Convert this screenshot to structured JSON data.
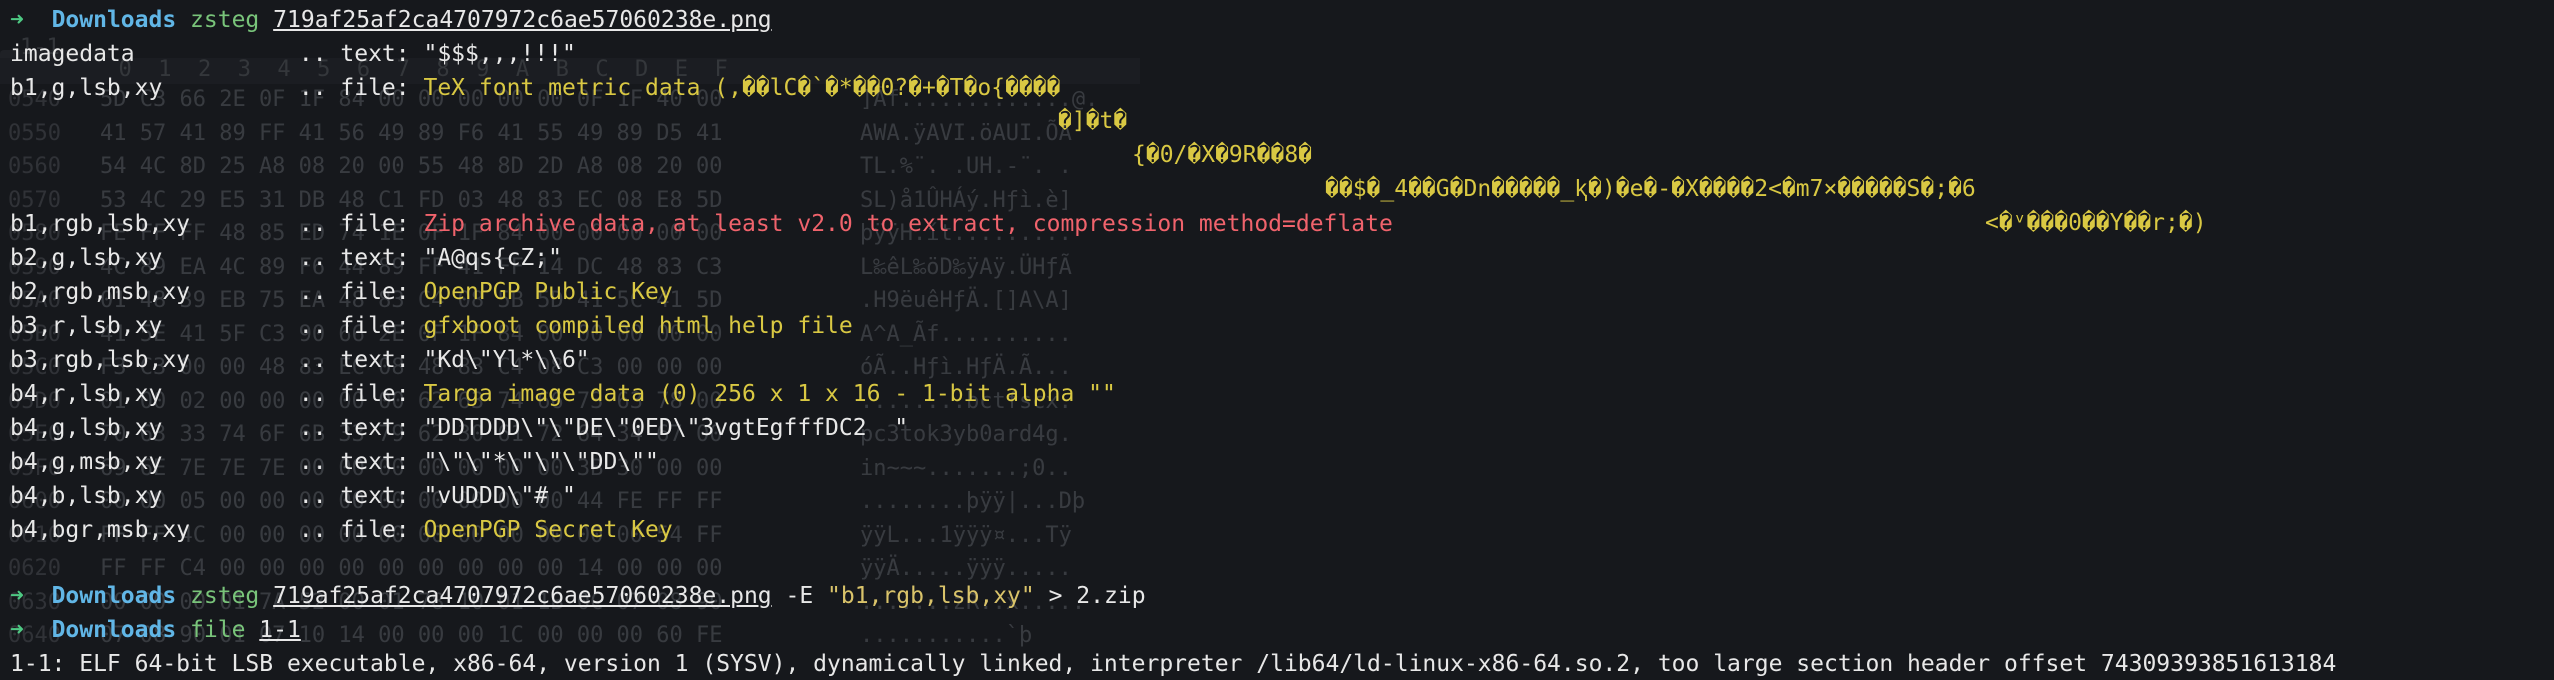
{
  "colors": {
    "background": "#16181c",
    "prompt_arrow": "#4ec983",
    "cwd": "#61b6e6",
    "command": "#79c47a",
    "file_type": "#d9c843",
    "zip_highlight": "#f0636c"
  },
  "prompts": [
    {
      "arrow": "➜",
      "cwd": "Downloads",
      "command": "zsteg",
      "path": "719af25af2ca4707972c6ae57060238e.png",
      "args": "",
      "string_arg": "",
      "redirect": ""
    },
    {
      "arrow": "➜",
      "cwd": "Downloads",
      "command": "zsteg",
      "path": "719af25af2ca4707972c6ae57060238e.png",
      "args": " -E ",
      "string_arg": "\"b1,rgb,lsb,xy\"",
      "redirect": " > 2.zip"
    },
    {
      "arrow": "➜",
      "cwd": "Downloads",
      "command": "file",
      "path": "1-1",
      "args": "",
      "string_arg": "",
      "redirect": ""
    }
  ],
  "results": [
    {
      "label": "imagedata",
      "sep": " .. ",
      "kind": "text: ",
      "value": "\"$$$,,,!!!\"",
      "style": "plain"
    },
    {
      "label": "b1,g,lsb,xy",
      "sep": " .. ",
      "kind": "file: ",
      "value": "TeX font metric data (,��lC�`�*��0?�+�T�o{����",
      "style": "file"
    },
    {
      "label": "b1,rgb,lsb,xy",
      "sep": " .. ",
      "kind": "file: ",
      "value": "Zip archive data, at least v2.0 to extract, compression method=deflate",
      "style": "zip"
    },
    {
      "label": "b2,g,lsb,xy",
      "sep": " .. ",
      "kind": "text: ",
      "value": "\"A@qs{cZ;\"",
      "style": "plain"
    },
    {
      "label": "b2,rgb,msb,xy",
      "sep": " .. ",
      "kind": "file: ",
      "value": "OpenPGP Public Key",
      "style": "file"
    },
    {
      "label": "b3,r,lsb,xy",
      "sep": " .. ",
      "kind": "file: ",
      "value": "gfxboot compiled html help file",
      "style": "file"
    },
    {
      "label": "b3,rgb,lsb,xy",
      "sep": " .. ",
      "kind": "text: ",
      "value": "\"Kd\\\"Yl*\\\\6\"",
      "style": "plain"
    },
    {
      "label": "b4,r,lsb,xy",
      "sep": " .. ",
      "kind": "file: ",
      "value": "Targa image data (0) 256 x 1 x 16 - 1-bit alpha \"\"",
      "style": "file"
    },
    {
      "label": "b4,g,lsb,xy",
      "sep": " .. ",
      "kind": "text: ",
      "value": "\"DDTDDD\\\"\\\"DE\\\"0ED\\\"3vgtEgfffDC2  \"",
      "style": "plain"
    },
    {
      "label": "b4,g,msb,xy",
      "sep": " .. ",
      "kind": "text: ",
      "value": "\"\\\"\\\"*\\\"\\\"\\\"DD\\\"\"",
      "style": "plain"
    },
    {
      "label": "b4,b,lsb,xy",
      "sep": " .. ",
      "kind": "text: ",
      "value": "\"vUDDD\\\"# \"",
      "style": "plain"
    },
    {
      "label": "b4,bgr,msb,xy",
      "sep": " .. ",
      "kind": "file: ",
      "value": "OpenPGP Secret Key",
      "style": "file"
    }
  ],
  "garbage_lines": [
    "�]�t�",
    "{�0/�X�9R��8�",
    "��$�_4��G�Dn�����_ⱪ�)�e�-�X����2<�m7×�����S�;�6",
    "<�ᵛ���0��Y��r;�)"
  ],
  "file_output": "1-1: ELF 64-bit LSB executable, x86-64, version 1 (SYSV), dynamically linked, interpreter /lib64/ld-linux-x86-64.so.2, too large section header offset 74309393851613184",
  "background_hexdump": {
    "tab_label": "1-1",
    "header": "  0  1  2  3  4  5  6  7  8  9  A  B  C  D  E  F",
    "rows": [
      {
        "offset": "0540",
        "hex": "5D C3 66 2E 0F 1F 84 00 00 00 00 00 0F 1F 40 00",
        "ascii": "]Ãf.............@."
      },
      {
        "offset": "0550",
        "hex": "41 57 41 89 FF 41 56 49 89 F6 41 55 49 89 D5 41",
        "ascii": "AWA.ÿAVI.öAUI.ÕA"
      },
      {
        "offset": "0560",
        "hex": "54 4C 8D 25 A8 08 20 00 55 48 8D 2D A8 08 20 00",
        "ascii": "TL.%¨. .UH.-¨. ."
      },
      {
        "offset": "0570",
        "hex": "53 4C 29 E5 31 DB 48 C1 FD 03 48 83 EC 08 E8 5D",
        "ascii": "SL)å1ÛHÁý.Hƒì.è]"
      },
      {
        "offset": "0580",
        "hex": "FE FF FF 48 85 ED 74 1E 0F 1F 84 00 00 00 00 00",
        "ascii": "þÿÿH.ít........."
      },
      {
        "offset": "0590",
        "hex": "4C 89 EA 4C 89 F6 44 89 FF 41 FF 14 DC 48 83 C3",
        "ascii": "L‰êL‰öD‰ÿAÿ.ÜHƒÃ"
      },
      {
        "offset": "05A0",
        "hex": "01 48 39 EB 75 EA 48 83 C4 08 5B 5D 41 5C 41 5D",
        "ascii": ".H9ëuêHƒÄ.[]A\\A]"
      },
      {
        "offset": "05B0",
        "hex": "41 5E 41 5F C3 90 66 2E 0F 1F 84 00 00 00 00 00",
        "ascii": "A^A_Ãf.........."
      },
      {
        "offset": "05C0",
        "hex": "F3 C3 00 00 48 83 EC 08 48 83 C4 08 C3 00 00 00",
        "ascii": "óÃ..Hƒì.HƒÄ.Ã..."
      },
      {
        "offset": "05D0",
        "hex": "01 00 02 00 00 00 00 00 62 63 74 66 73 63 78 00",
        "ascii": "........bctfscx."
      },
      {
        "offset": "05E0",
        "hex": "70 63 33 74 6F 6B 33 79 62 30 61 72 64 34 67 00",
        "ascii": "pc3tok3yb0ard4g."
      },
      {
        "offset": "05F0",
        "hex": "69 6E 7E 7E 7E 00 00 00 00 00 00 00 3B 30 00 00",
        "ascii": "in~~~.......;0.."
      },
      {
        "offset": "0600",
        "hex": "00 00 05 00 00 00 00 00 00 00 00 00 44 FE FF FF",
        "ascii": "........þÿÿ|...Dþ"
      },
      {
        "offset": "0610",
        "hex": "FF FF 4C 00 00 00 00 00 00 00 00 00 00 00 54 FF",
        "ascii": "ÿÿL...1ÿÿÿ¤...Tÿ"
      },
      {
        "offset": "0620",
        "hex": "FF FF C4 00 00 00 00 00 00 00 00 00 14 00 00 00",
        "ascii": "ÿÿÄ.....ÿÿÿ....."
      },
      {
        "offset": "0630",
        "hex": "00 00 00 01 7A 52 00 01 78 10 01 1B 0C 07 08 90",
        "ascii": ".......zR..x....."
      },
      {
        "offset": "0640",
        "hex": "07 08 90 01 07 10 14 00 00 00 1C 00 00 00 60 FE",
        "ascii": "...........`þ"
      }
    ]
  }
}
